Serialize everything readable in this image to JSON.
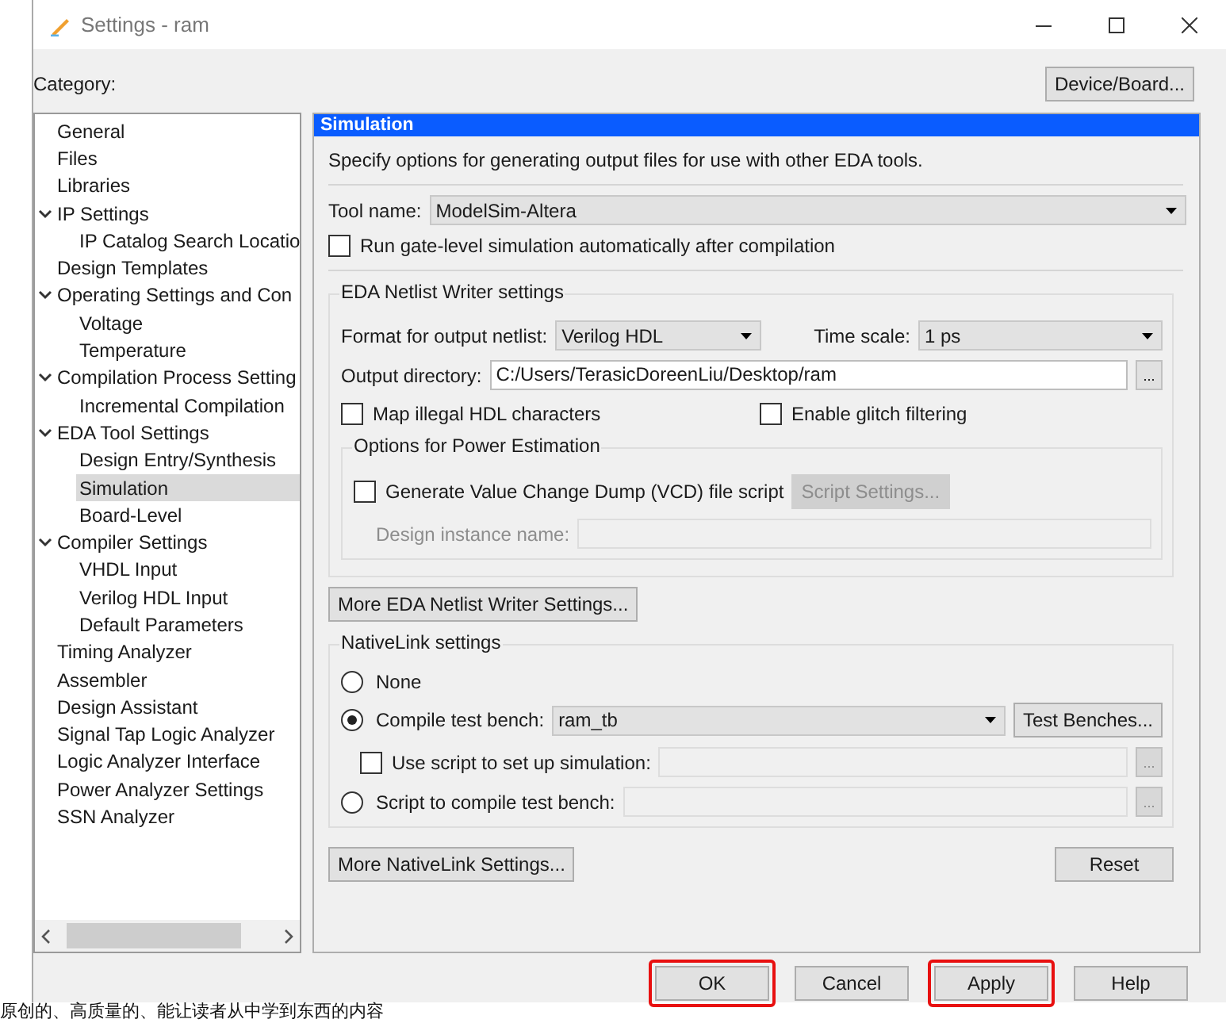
{
  "window": {
    "title": "Settings - ram"
  },
  "category_label": "Category:",
  "device_board_button": "Device/Board...",
  "tree": [
    {
      "label": "General",
      "selected": false
    },
    {
      "label": "Files",
      "selected": false
    },
    {
      "label": "Libraries",
      "selected": false
    },
    {
      "label": "IP Settings",
      "selected": false,
      "expanded": true,
      "children": [
        {
          "label": "IP Catalog Search Locatio",
          "selected": false
        }
      ]
    },
    {
      "label": "Design Templates",
      "selected": false
    },
    {
      "label": "Operating Settings and Con",
      "selected": false,
      "expanded": true,
      "children": [
        {
          "label": "Voltage",
          "selected": false
        },
        {
          "label": "Temperature",
          "selected": false
        }
      ]
    },
    {
      "label": "Compilation Process Setting",
      "selected": false,
      "expanded": true,
      "children": [
        {
          "label": "Incremental Compilation",
          "selected": false
        }
      ]
    },
    {
      "label": "EDA Tool Settings",
      "selected": false,
      "expanded": true,
      "children": [
        {
          "label": "Design Entry/Synthesis",
          "selected": false
        },
        {
          "label": "Simulation",
          "selected": true
        },
        {
          "label": "Board-Level",
          "selected": false
        }
      ]
    },
    {
      "label": "Compiler Settings",
      "selected": false,
      "expanded": true,
      "children": [
        {
          "label": "VHDL Input",
          "selected": false
        },
        {
          "label": "Verilog HDL Input",
          "selected": false
        },
        {
          "label": "Default Parameters",
          "selected": false
        }
      ]
    },
    {
      "label": "Timing Analyzer",
      "selected": false
    },
    {
      "label": "Assembler",
      "selected": false
    },
    {
      "label": "Design Assistant",
      "selected": false
    },
    {
      "label": "Signal Tap Logic Analyzer",
      "selected": false
    },
    {
      "label": "Logic Analyzer Interface",
      "selected": false
    },
    {
      "label": "Power Analyzer Settings",
      "selected": false
    },
    {
      "label": "SSN Analyzer",
      "selected": false
    }
  ],
  "panel": {
    "title": "Simulation",
    "description": "Specify options for generating output files for use with other EDA tools.",
    "tool_name": {
      "label": "Tool name:",
      "value": "ModelSim-Altera"
    },
    "run_gate_level": {
      "label": "Run gate-level simulation automatically after compilation",
      "checked": false
    },
    "netlist_group": {
      "title": "EDA Netlist Writer settings",
      "format": {
        "label": "Format for output netlist:",
        "value": "Verilog HDL"
      },
      "time_scale": {
        "label": "Time scale:",
        "value": "1 ps"
      },
      "output_directory": {
        "label": "Output directory:",
        "value": "C:/Users/TerasicDoreenLiu/Desktop/ram",
        "browse": "..."
      },
      "map_illegal": {
        "label": "Map illegal HDL characters",
        "checked": false
      },
      "glitch": {
        "label": "Enable glitch filtering",
        "checked": false
      },
      "power_group": {
        "title": "Options for Power Estimation",
        "vcd": {
          "label": "Generate Value Change Dump (VCD) file script",
          "checked": false
        },
        "script_settings_button": {
          "label": "Script Settings...",
          "disabled": true
        },
        "design_instance": {
          "label": "Design instance name:",
          "disabled": true
        }
      }
    },
    "more_eda_button": "More EDA Netlist Writer Settings...",
    "nativelink_group": {
      "title": "NativeLink settings",
      "none": {
        "label": "None",
        "selected": false
      },
      "compile_test_bench": {
        "label": "Compile test bench:",
        "selected": true,
        "value": "ram_tb",
        "button": "Test Benches..."
      },
      "use_script": {
        "label": "Use script to set up simulation:",
        "checked": false,
        "browse": "..."
      },
      "script_compile": {
        "label": "Script to compile test bench:",
        "selected": false,
        "browse": "..."
      }
    },
    "more_nativelink_button": "More NativeLink Settings...",
    "reset_button": "Reset"
  },
  "buttons": [
    {
      "label": "OK",
      "highlighted": true
    },
    {
      "label": "Cancel",
      "highlighted": false
    },
    {
      "label": "Apply",
      "highlighted": true
    },
    {
      "label": "Help",
      "highlighted": false
    }
  ],
  "background_text": "原创的、高质量的、能让读者从中学到东西的内容"
}
